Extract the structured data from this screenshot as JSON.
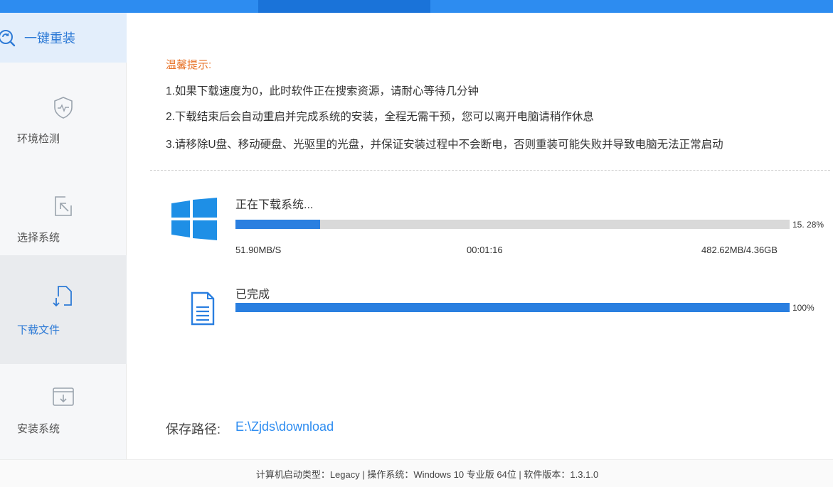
{
  "sidebar": {
    "header": {
      "label": "一键重装",
      "icon": "search-refresh-icon"
    },
    "items": [
      {
        "label": "环境检测",
        "icon": "shield-icon"
      },
      {
        "label": "选择系统",
        "icon": "cursor-select-icon"
      },
      {
        "label": "下载文件",
        "icon": "download-file-icon",
        "active": true
      },
      {
        "label": "安装系统",
        "icon": "install-box-icon"
      }
    ]
  },
  "tips": {
    "title": "温馨提示:",
    "lines": [
      "1.如果下载速度为0，此时软件正在搜索资源，请耐心等待几分钟",
      "2.下载结束后会自动重启并完成系统的安装，全程无需干预，您可以离开电脑请稍作休息",
      "3.请移除U盘、移动硬盘、光驱里的光盘，并保证安装过程中不会断电，否则重装可能失败并导致电脑无法正常启动"
    ]
  },
  "download": {
    "title": "正在下载系统...",
    "progress": 15.28,
    "progress_label": "15. 28%",
    "speed": "51.90MB/S",
    "elapsed": "00:01:16",
    "size": "482.62MB/4.36GB"
  },
  "completed": {
    "title": "已完成",
    "progress": 100,
    "progress_label": "100%"
  },
  "save": {
    "label": "保存路径:",
    "path": "E:\\Zjds\\download"
  },
  "footer": {
    "text": "计算机启动类型：Legacy | 操作系统：Windows 10 专业版 64位 | 软件版本：1.3.1.0"
  },
  "colors": {
    "accent": "#2d8cf0",
    "progress": "#2a7fe0",
    "tip_title": "#e8742a"
  }
}
